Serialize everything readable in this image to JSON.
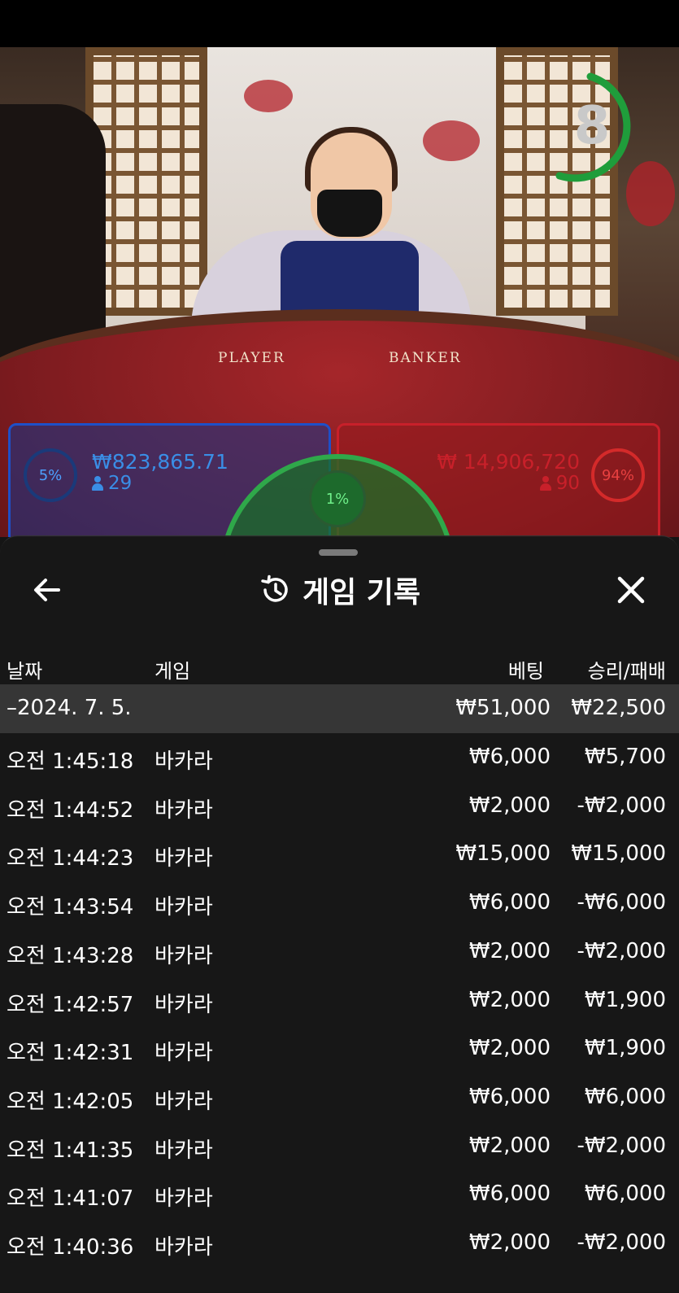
{
  "stream": {
    "countdown": "8",
    "table_labels": {
      "player": "PLAYER",
      "banker": "BANKER"
    }
  },
  "bets": {
    "player": {
      "percent": "5%",
      "amount": "₩823,865.71",
      "count": "29",
      "color": "#2a7fd4"
    },
    "tie": {
      "percent": "1%",
      "color": "#2fa84a"
    },
    "banker": {
      "percent": "94%",
      "amount": "₩ 14,906,720",
      "count": "90",
      "color": "#c8202a"
    }
  },
  "sheet": {
    "title": "게임 기록",
    "icons": {
      "back": "arrow-left-icon",
      "history": "history-icon",
      "close": "close-icon"
    },
    "columns": {
      "date": "날짜",
      "game": "게임",
      "bet": "베팅",
      "result": "승리/패배"
    },
    "summary": {
      "date": "–2024. 7. 5.",
      "bet": "₩51,000",
      "result": "₩22,500"
    },
    "rows": [
      {
        "time": "오전 1:45:18",
        "game": "바카라",
        "bet": "₩6,000",
        "result": "₩5,700"
      },
      {
        "time": "오전 1:44:52",
        "game": "바카라",
        "bet": "₩2,000",
        "result": "-₩2,000"
      },
      {
        "time": "오전 1:44:23",
        "game": "바카라",
        "bet": "₩15,000",
        "result": "₩15,000"
      },
      {
        "time": "오전 1:43:54",
        "game": "바카라",
        "bet": "₩6,000",
        "result": "-₩6,000"
      },
      {
        "time": "오전 1:43:28",
        "game": "바카라",
        "bet": "₩2,000",
        "result": "-₩2,000"
      },
      {
        "time": "오전 1:42:57",
        "game": "바카라",
        "bet": "₩2,000",
        "result": "₩1,900"
      },
      {
        "time": "오전 1:42:31",
        "game": "바카라",
        "bet": "₩2,000",
        "result": "₩1,900"
      },
      {
        "time": "오전 1:42:05",
        "game": "바카라",
        "bet": "₩6,000",
        "result": "₩6,000"
      },
      {
        "time": "오전 1:41:35",
        "game": "바카라",
        "bet": "₩2,000",
        "result": "-₩2,000"
      },
      {
        "time": "오전 1:41:07",
        "game": "바카라",
        "bet": "₩6,000",
        "result": "₩6,000"
      },
      {
        "time": "오전 1:40:36",
        "game": "바카라",
        "bet": "₩2,000",
        "result": "-₩2,000"
      }
    ]
  }
}
